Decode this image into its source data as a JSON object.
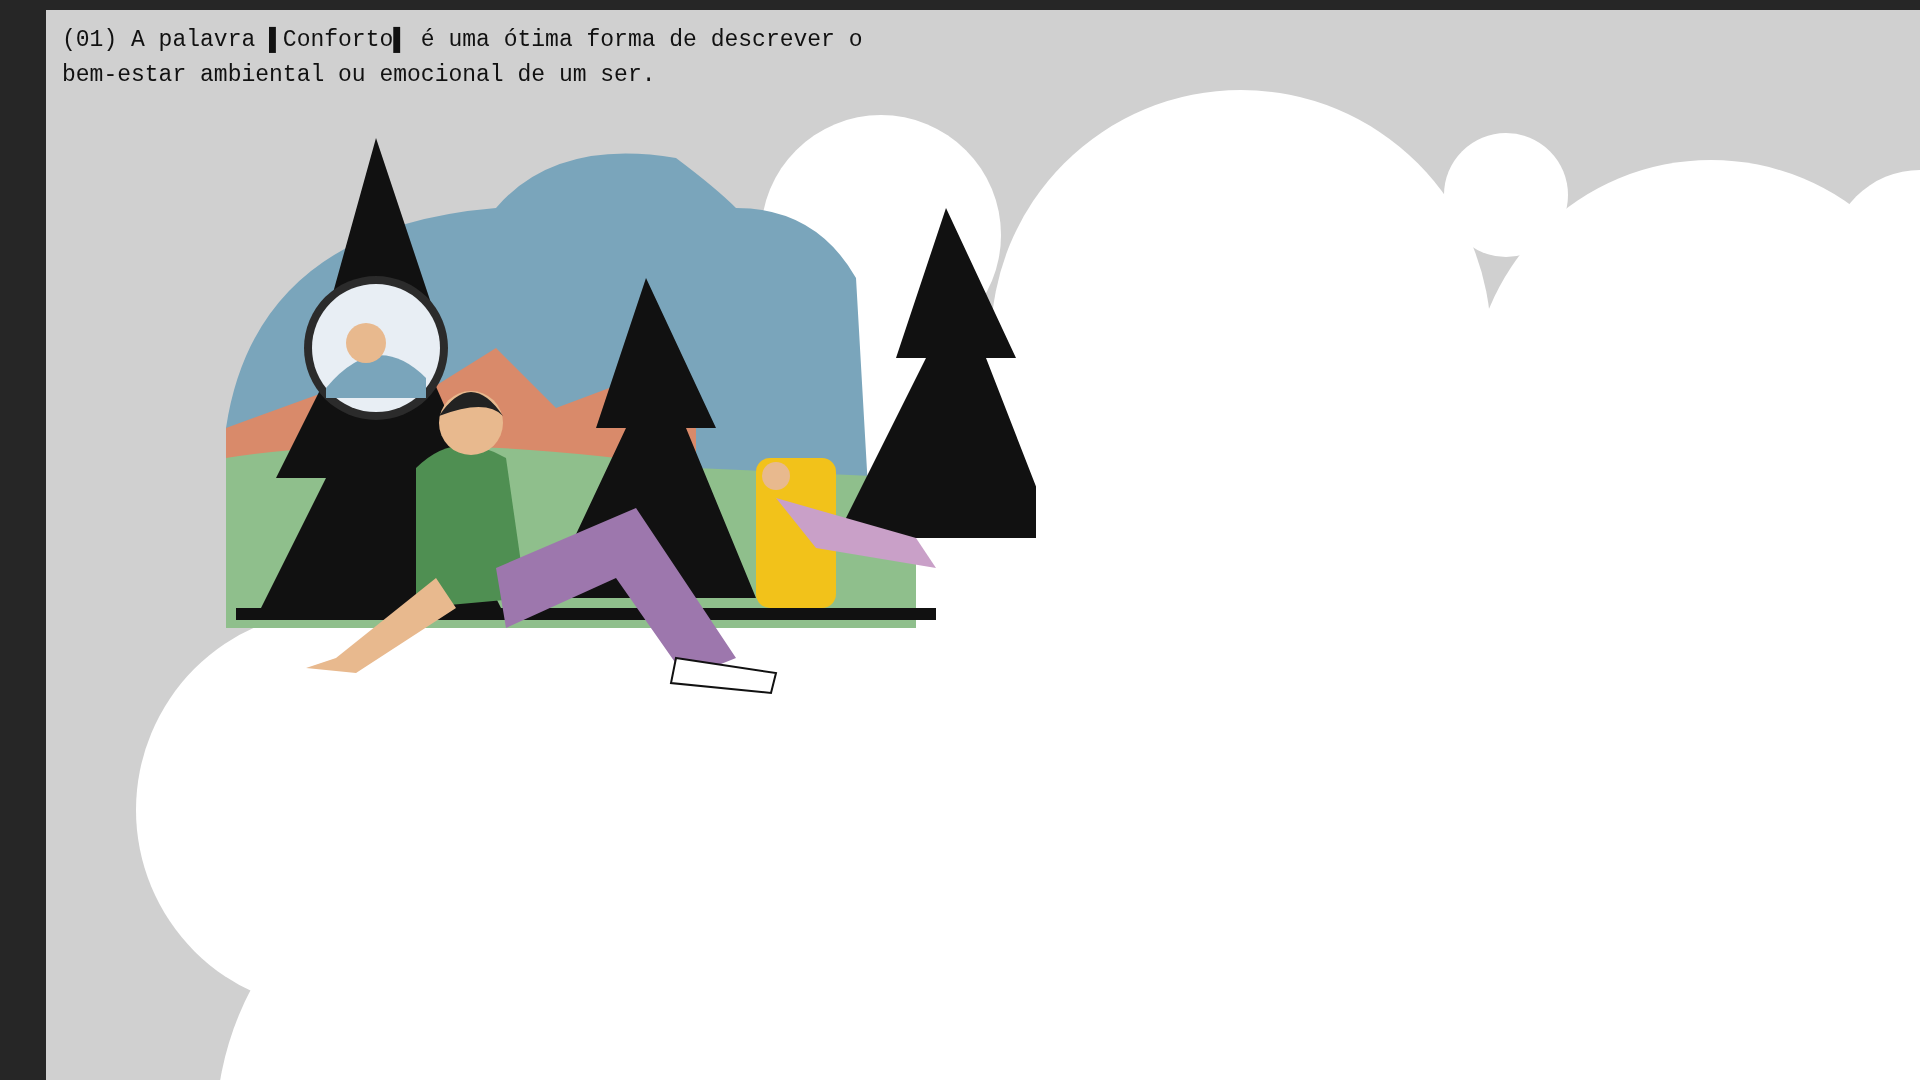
{
  "slide": {
    "text": "(01) A palavra ▌Conforto▌ é uma ótima forma de descrever o bem-estar ambiental ou emocional de um ser."
  }
}
